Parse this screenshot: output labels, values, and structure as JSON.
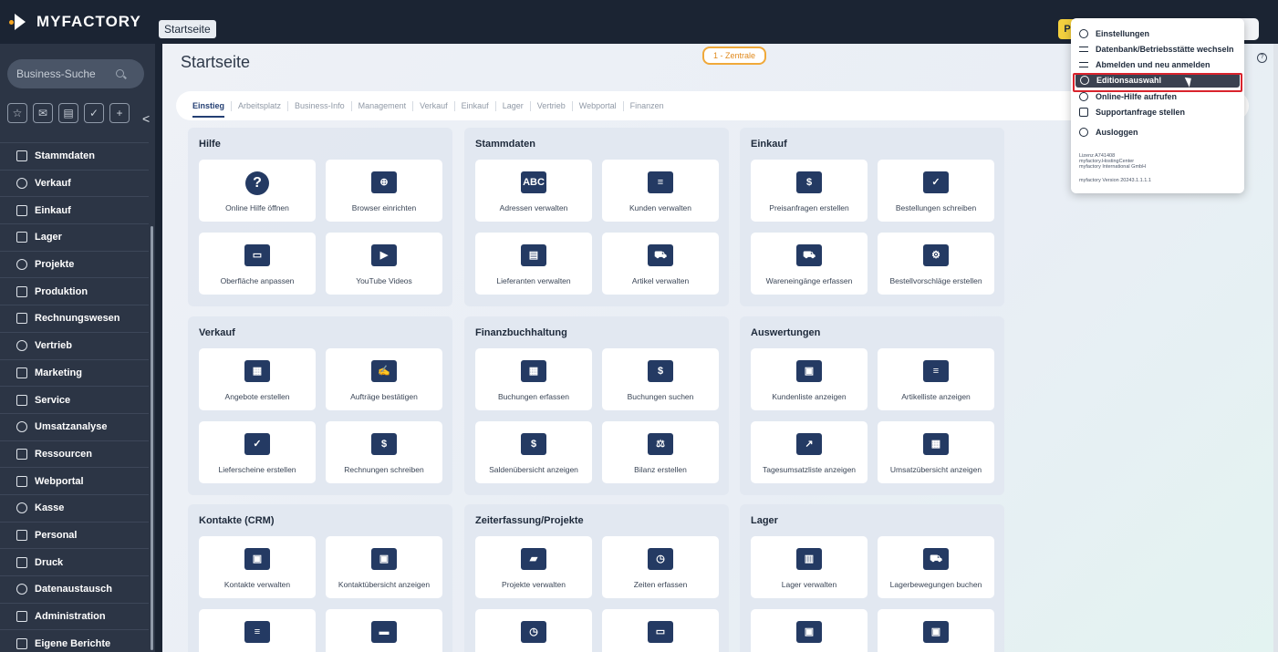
{
  "app": {
    "name": "MYFACTORY",
    "breadcrumb": "Startseite",
    "top_badge": "P"
  },
  "sidebar": {
    "search_placeholder": "Business-Suche",
    "collapse": "<",
    "quick_icons": [
      "star-icon",
      "inbox-icon",
      "calendar-icon",
      "check-icon",
      "plus-icon"
    ],
    "items": [
      {
        "label": "Stammdaten"
      },
      {
        "label": "Verkauf"
      },
      {
        "label": "Einkauf"
      },
      {
        "label": "Lager"
      },
      {
        "label": "Projekte"
      },
      {
        "label": "Produktion"
      },
      {
        "label": "Rechnungswesen"
      },
      {
        "label": "Vertrieb"
      },
      {
        "label": "Marketing"
      },
      {
        "label": "Service"
      },
      {
        "label": "Umsatzanalyse"
      },
      {
        "label": "Ressourcen"
      },
      {
        "label": "Webportal"
      },
      {
        "label": "Kasse"
      },
      {
        "label": "Personal"
      },
      {
        "label": "Druck"
      },
      {
        "label": "Datenaustausch"
      },
      {
        "label": "Administration"
      },
      {
        "label": "Eigene Berichte"
      }
    ]
  },
  "main": {
    "title": "Startseite",
    "site_badge": "1 - Zentrale",
    "tabs": [
      "Einstieg",
      "Arbeitsplatz",
      "Business-Info",
      "Management",
      "Verkauf",
      "Einkauf",
      "Lager",
      "Vertrieb",
      "Webportal",
      "Finanzen"
    ],
    "panels": [
      {
        "title": "Hilfe",
        "tiles": [
          {
            "label": "Online Hilfe öffnen",
            "glyph": "?"
          },
          {
            "label": "Browser einrichten",
            "glyph": "⊕"
          },
          {
            "label": "Oberfläche anpassen",
            "glyph": "▭"
          },
          {
            "label": "YouTube Videos",
            "glyph": "▶"
          }
        ]
      },
      {
        "title": "Stammdaten",
        "tiles": [
          {
            "label": "Adressen verwalten",
            "glyph": "ABC"
          },
          {
            "label": "Kunden verwalten",
            "glyph": "≡"
          },
          {
            "label": "Lieferanten verwalten",
            "glyph": "▤"
          },
          {
            "label": "Artikel verwalten",
            "glyph": "⛟"
          }
        ]
      },
      {
        "title": "Einkauf",
        "tiles": [
          {
            "label": "Preisanfragen erstellen",
            "glyph": "$"
          },
          {
            "label": "Bestellungen schreiben",
            "glyph": "✓"
          },
          {
            "label": "Wareneingänge erfassen",
            "glyph": "⛟"
          },
          {
            "label": "Bestellvorschläge erstellen",
            "glyph": "⚙"
          }
        ]
      },
      {
        "title": "Verkauf",
        "tiles": [
          {
            "label": "Angebote erstellen",
            "glyph": "▦"
          },
          {
            "label": "Aufträge bestätigen",
            "glyph": "✍"
          },
          {
            "label": "Lieferscheine erstellen",
            "glyph": "✓"
          },
          {
            "label": "Rechnungen schreiben",
            "glyph": "$"
          }
        ]
      },
      {
        "title": "Finanzbuchhaltung",
        "tiles": [
          {
            "label": "Buchungen erfassen",
            "glyph": "▦"
          },
          {
            "label": "Buchungen suchen",
            "glyph": "$"
          },
          {
            "label": "Saldenübersicht anzeigen",
            "glyph": "$"
          },
          {
            "label": "Bilanz erstellen",
            "glyph": "⚖"
          }
        ]
      },
      {
        "title": "Auswertungen",
        "tiles": [
          {
            "label": "Kundenliste anzeigen",
            "glyph": "▣"
          },
          {
            "label": "Artikelliste anzeigen",
            "glyph": "≡"
          },
          {
            "label": "Tagesumsatzliste anzeigen",
            "glyph": "↗"
          },
          {
            "label": "Umsatzübersicht anzeigen",
            "glyph": "▦"
          }
        ]
      },
      {
        "title": "Kontakte (CRM)",
        "tiles": [
          {
            "label": "Kontakte verwalten",
            "glyph": "▣"
          },
          {
            "label": "Kontaktübersicht anzeigen",
            "glyph": "▣"
          },
          {
            "label": "",
            "glyph": "≡"
          },
          {
            "label": "",
            "glyph": "▬"
          }
        ]
      },
      {
        "title": "Zeiterfassung/Projekte",
        "tiles": [
          {
            "label": "Projekte verwalten",
            "glyph": "▰"
          },
          {
            "label": "Zeiten erfassen",
            "glyph": "◷"
          },
          {
            "label": "",
            "glyph": "◷"
          },
          {
            "label": "",
            "glyph": "▭"
          }
        ]
      },
      {
        "title": "Lager",
        "tiles": [
          {
            "label": "Lager verwalten",
            "glyph": "▥"
          },
          {
            "label": "Lagerbewegungen buchen",
            "glyph": "⛟"
          },
          {
            "label": "",
            "glyph": "▣"
          },
          {
            "label": "",
            "glyph": "▣"
          }
        ]
      }
    ]
  },
  "menu": {
    "items": [
      {
        "label": "Einstellungen",
        "icon": "gear-icon"
      },
      {
        "label": "Datenbank/Betriebsstätte wechseln",
        "icon": "swap-icon"
      },
      {
        "label": "Abmelden und neu anmelden",
        "icon": "swap-icon"
      },
      {
        "label": "Editionsauswahl",
        "icon": "gear-icon"
      },
      {
        "label": "Online-Hilfe aufrufen",
        "icon": "help-icon"
      },
      {
        "label": "Supportanfrage stellen",
        "icon": "mail-icon"
      },
      {
        "label": "Ausloggen",
        "icon": "logout-icon"
      }
    ],
    "license_lines": [
      "Lizenz A741408",
      "myfactory.HostingCenter",
      "myfactory International GmbH"
    ],
    "version": "myfactory Version 20243.1.1.1.1"
  },
  "colors": {
    "topbar": "#1b2433",
    "sidebar": "#2c3545",
    "accent": "#243a63",
    "highlight": "#d9232d",
    "badge": "#f0a93a"
  }
}
